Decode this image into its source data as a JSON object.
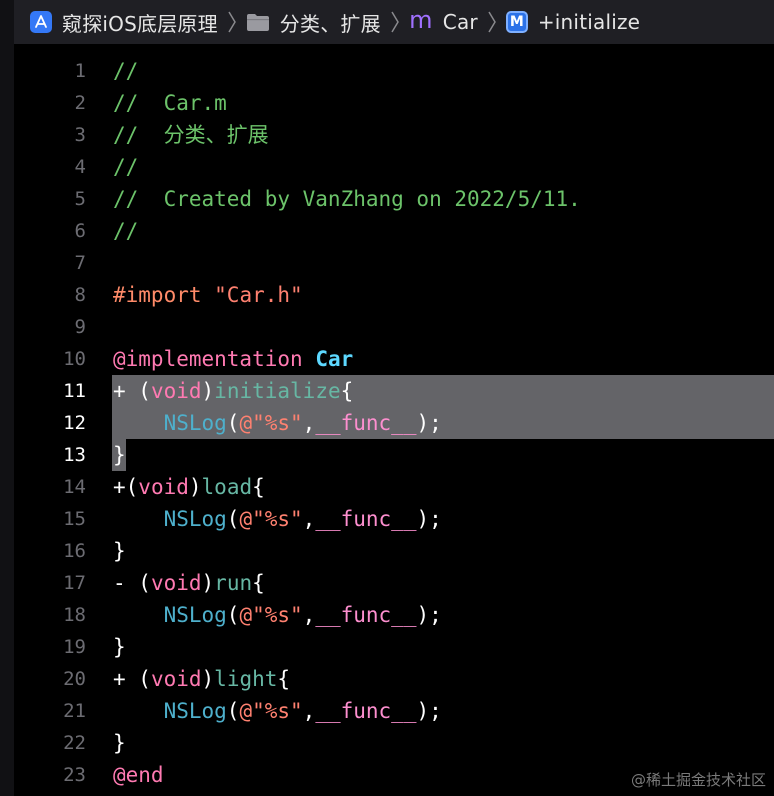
{
  "breadcrumb": {
    "project": "窥探iOS底层原理",
    "group": "分类、扩展",
    "file": "Car",
    "symbol": "+initialize"
  },
  "icons": {
    "project": "xcode-project-icon",
    "group": "folder-icon",
    "file": "objc-m-file-icon",
    "symbol": "method-icon",
    "separator": "chevron-right-icon"
  },
  "editor": {
    "lines": [
      {
        "n": "1",
        "tokens": [
          {
            "t": "//",
            "c": "comment"
          }
        ]
      },
      {
        "n": "2",
        "tokens": [
          {
            "t": "//  Car.m",
            "c": "comment"
          }
        ]
      },
      {
        "n": "3",
        "tokens": [
          {
            "t": "//  分类、扩展",
            "c": "comment"
          }
        ]
      },
      {
        "n": "4",
        "tokens": [
          {
            "t": "//",
            "c": "comment"
          }
        ]
      },
      {
        "n": "5",
        "tokens": [
          {
            "t": "//  Created by VanZhang on 2022/5/11.",
            "c": "comment"
          }
        ]
      },
      {
        "n": "6",
        "tokens": [
          {
            "t": "//",
            "c": "comment"
          }
        ]
      },
      {
        "n": "7",
        "tokens": []
      },
      {
        "n": "8",
        "tokens": [
          {
            "t": "#import ",
            "c": "pre"
          },
          {
            "t": "\"Car.h\"",
            "c": "str"
          }
        ]
      },
      {
        "n": "9",
        "tokens": []
      },
      {
        "n": "10",
        "tokens": [
          {
            "t": "@implementation",
            "c": "kw"
          },
          {
            "t": " ",
            "c": "plain"
          },
          {
            "t": "Car",
            "c": "cls"
          }
        ]
      },
      {
        "n": "11",
        "highlight": true,
        "tokens": [
          {
            "t": "+ (",
            "c": "plain"
          },
          {
            "t": "void",
            "c": "kw"
          },
          {
            "t": ")",
            "c": "plain"
          },
          {
            "t": "initialize",
            "c": "fn"
          },
          {
            "t": "{",
            "c": "plain"
          }
        ]
      },
      {
        "n": "12",
        "highlight": true,
        "tokens": [
          {
            "t": "    ",
            "c": "plain"
          },
          {
            "t": "NSLog",
            "c": "call"
          },
          {
            "t": "(",
            "c": "plain"
          },
          {
            "t": "@\"%s\"",
            "c": "str"
          },
          {
            "t": ",",
            "c": "plain"
          },
          {
            "t": "__func__",
            "c": "macro"
          },
          {
            "t": ");",
            "c": "plain"
          }
        ]
      },
      {
        "n": "13",
        "highlight": true,
        "hlShort": true,
        "tokens": [
          {
            "t": "}",
            "c": "plain"
          }
        ]
      },
      {
        "n": "14",
        "tokens": [
          {
            "t": "+(",
            "c": "plain"
          },
          {
            "t": "void",
            "c": "kw"
          },
          {
            "t": ")",
            "c": "plain"
          },
          {
            "t": "load",
            "c": "fn"
          },
          {
            "t": "{",
            "c": "plain"
          }
        ]
      },
      {
        "n": "15",
        "tokens": [
          {
            "t": "    ",
            "c": "plain"
          },
          {
            "t": "NSLog",
            "c": "call"
          },
          {
            "t": "(",
            "c": "plain"
          },
          {
            "t": "@\"%s\"",
            "c": "str"
          },
          {
            "t": ",",
            "c": "plain"
          },
          {
            "t": "__func__",
            "c": "macro"
          },
          {
            "t": ");",
            "c": "plain"
          }
        ]
      },
      {
        "n": "16",
        "tokens": [
          {
            "t": "}",
            "c": "plain"
          }
        ]
      },
      {
        "n": "17",
        "tokens": [
          {
            "t": "- (",
            "c": "plain"
          },
          {
            "t": "void",
            "c": "kw"
          },
          {
            "t": ")",
            "c": "plain"
          },
          {
            "t": "run",
            "c": "fn"
          },
          {
            "t": "{",
            "c": "plain"
          }
        ]
      },
      {
        "n": "18",
        "tokens": [
          {
            "t": "    ",
            "c": "plain"
          },
          {
            "t": "NSLog",
            "c": "call"
          },
          {
            "t": "(",
            "c": "plain"
          },
          {
            "t": "@\"%s\"",
            "c": "str"
          },
          {
            "t": ",",
            "c": "plain"
          },
          {
            "t": "__func__",
            "c": "macro"
          },
          {
            "t": ");",
            "c": "plain"
          }
        ]
      },
      {
        "n": "19",
        "tokens": [
          {
            "t": "}",
            "c": "plain"
          }
        ]
      },
      {
        "n": "20",
        "tokens": [
          {
            "t": "+ (",
            "c": "plain"
          },
          {
            "t": "void",
            "c": "kw"
          },
          {
            "t": ")",
            "c": "plain"
          },
          {
            "t": "light",
            "c": "fn"
          },
          {
            "t": "{",
            "c": "plain"
          }
        ]
      },
      {
        "n": "21",
        "tokens": [
          {
            "t": "    ",
            "c": "plain"
          },
          {
            "t": "NSLog",
            "c": "call"
          },
          {
            "t": "(",
            "c": "plain"
          },
          {
            "t": "@\"%s\"",
            "c": "str"
          },
          {
            "t": ",",
            "c": "plain"
          },
          {
            "t": "__func__",
            "c": "macro"
          },
          {
            "t": ");",
            "c": "plain"
          }
        ]
      },
      {
        "n": "22",
        "tokens": [
          {
            "t": "}",
            "c": "plain"
          }
        ]
      },
      {
        "n": "23",
        "tokens": [
          {
            "t": "@end",
            "c": "kw"
          }
        ]
      }
    ]
  },
  "watermark": "@稀土掘金技术社区",
  "colors": {
    "background": "#000000",
    "jumpbar": "#1f1f24",
    "selection": "#646468",
    "comment": "#6cc36a",
    "keyword": "#ff7ab2",
    "string": "#ff8170",
    "class": "#5dd8ff"
  }
}
